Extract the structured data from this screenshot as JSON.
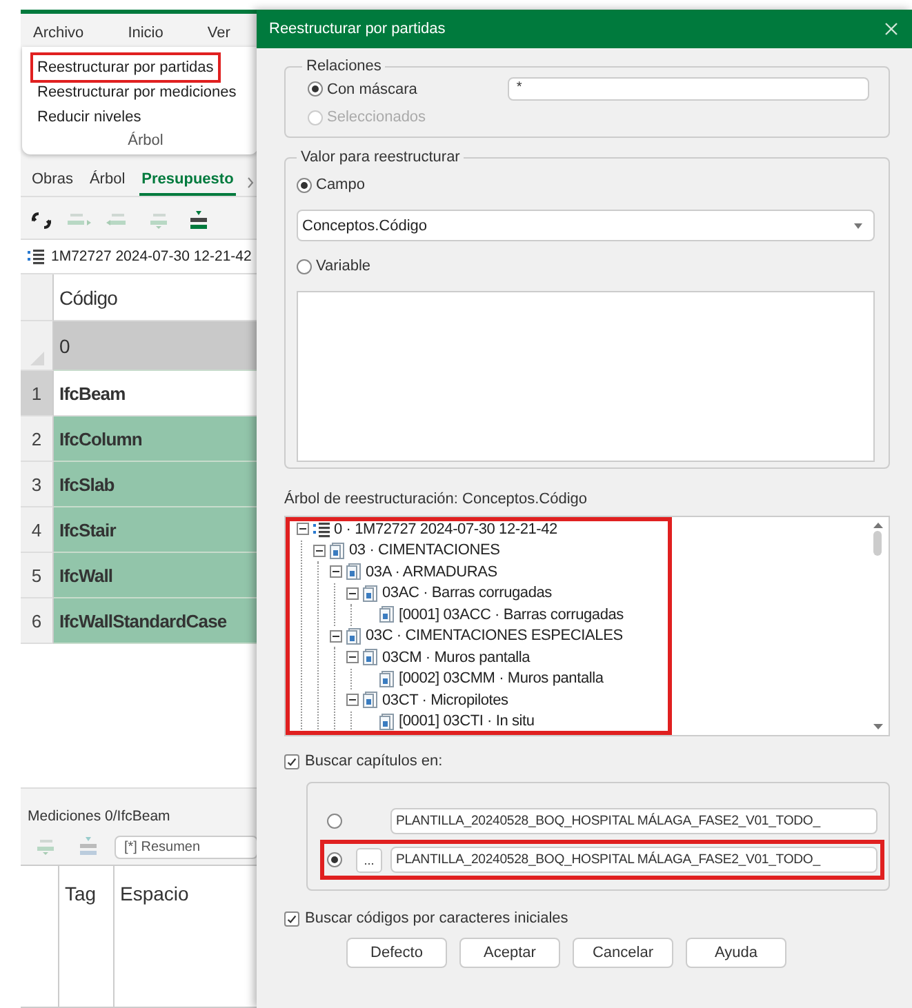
{
  "app": {
    "menu": [
      {
        "label": "Archivo"
      },
      {
        "label": "Inicio"
      },
      {
        "label": "Ver"
      }
    ],
    "ribbon_menu": {
      "items": [
        {
          "label": "Reestructurar por partidas",
          "highlighted": true
        },
        {
          "label": "Reestructurar por mediciones",
          "highlighted": false
        },
        {
          "label": "Reducir niveles",
          "highlighted": false
        }
      ],
      "group": "Árbol"
    },
    "tabs": [
      {
        "label": "Obras",
        "selected": false
      },
      {
        "label": "Árbol",
        "selected": false
      },
      {
        "label": "Presupuesto",
        "selected": true
      }
    ],
    "budget_title": "1M72727 2024-07-30 12-21-42",
    "table": {
      "columns": [
        "Código"
      ],
      "filter_row": "0",
      "rows": [
        {
          "number": "1",
          "code": "IfcBeam",
          "selected": false,
          "current": true
        },
        {
          "number": "2",
          "code": "IfcColumn",
          "selected": true,
          "current": false
        },
        {
          "number": "3",
          "code": "IfcSlab",
          "selected": true,
          "current": false
        },
        {
          "number": "4",
          "code": "IfcStair",
          "selected": true,
          "current": false
        },
        {
          "number": "5",
          "code": "IfcWall",
          "selected": true,
          "current": false
        },
        {
          "number": "6",
          "code": "IfcWallStandardCase",
          "selected": true,
          "current": false
        }
      ]
    },
    "measurements": {
      "title": "Mediciones 0/IfcBeam",
      "view": "[*] Resumen",
      "columns": [
        "Tag",
        "Espacio"
      ]
    }
  },
  "dialog": {
    "title": "Reestructurar por partidas",
    "relations": {
      "legend": "Relaciones",
      "options": [
        {
          "label": "Con máscara",
          "selected": true,
          "disabled": false
        },
        {
          "label": "Seleccionados",
          "selected": false,
          "disabled": true
        }
      ],
      "mask": "*"
    },
    "value": {
      "legend": "Valor para reestructurar",
      "options": [
        {
          "label": "Campo",
          "selected": true
        },
        {
          "label": "Variable",
          "selected": false
        }
      ],
      "field": "Conceptos.Código"
    },
    "tree_label": "Árbol de reestructuración: Conceptos.Código",
    "tree": {
      "highlighted": true,
      "nodes": [
        {
          "kind": "root",
          "label": "0 · 1M72727 2024-07-30 12-21-42",
          "expanded": true,
          "children": [
            {
              "kind": "chapter",
              "label": "03 · CIMENTACIONES",
              "expanded": true,
              "children": [
                {
                  "kind": "chapter",
                  "label": "03A · ARMADURAS",
                  "expanded": true,
                  "children": [
                    {
                      "kind": "chapter",
                      "label": "03AC · Barras corrugadas",
                      "expanded": true,
                      "children": [
                        {
                          "kind": "chapter",
                          "label": "[0001] 03ACC · Barras corrugadas"
                        }
                      ]
                    }
                  ]
                },
                {
                  "kind": "chapter",
                  "label": "03C · CIMENTACIONES ESPECIALES",
                  "expanded": true,
                  "children": [
                    {
                      "kind": "chapter",
                      "label": "03CM · Muros pantalla",
                      "expanded": true,
                      "children": [
                        {
                          "kind": "chapter",
                          "label": "[0002] 03CMM · Muros pantalla"
                        }
                      ]
                    },
                    {
                      "kind": "chapter",
                      "label": "03CT · Micropilotes",
                      "expanded": true,
                      "children": [
                        {
                          "kind": "chapter",
                          "label": "[0001] 03CTI · In situ"
                        }
                      ]
                    }
                  ]
                }
              ]
            }
          ]
        }
      ]
    },
    "search_chapters": {
      "label": "Buscar capítulos en:",
      "checked": true,
      "sources": [
        {
          "path": "PLANTILLA_20240528_BOQ_HOSPITAL MÁLAGA_FASE2_V01_TODO_",
          "selected": false,
          "highlighted": false
        },
        {
          "path": "PLANTILLA_20240528_BOQ_HOSPITAL MÁLAGA_FASE2_V01_TODO_",
          "selected": true,
          "highlighted": true,
          "browse": "..."
        }
      ]
    },
    "search_codes": {
      "label": "Buscar códigos por caracteres iniciales",
      "checked": true
    },
    "buttons": [
      "Defecto",
      "Aceptar",
      "Cancelar",
      "Ayuda"
    ]
  }
}
